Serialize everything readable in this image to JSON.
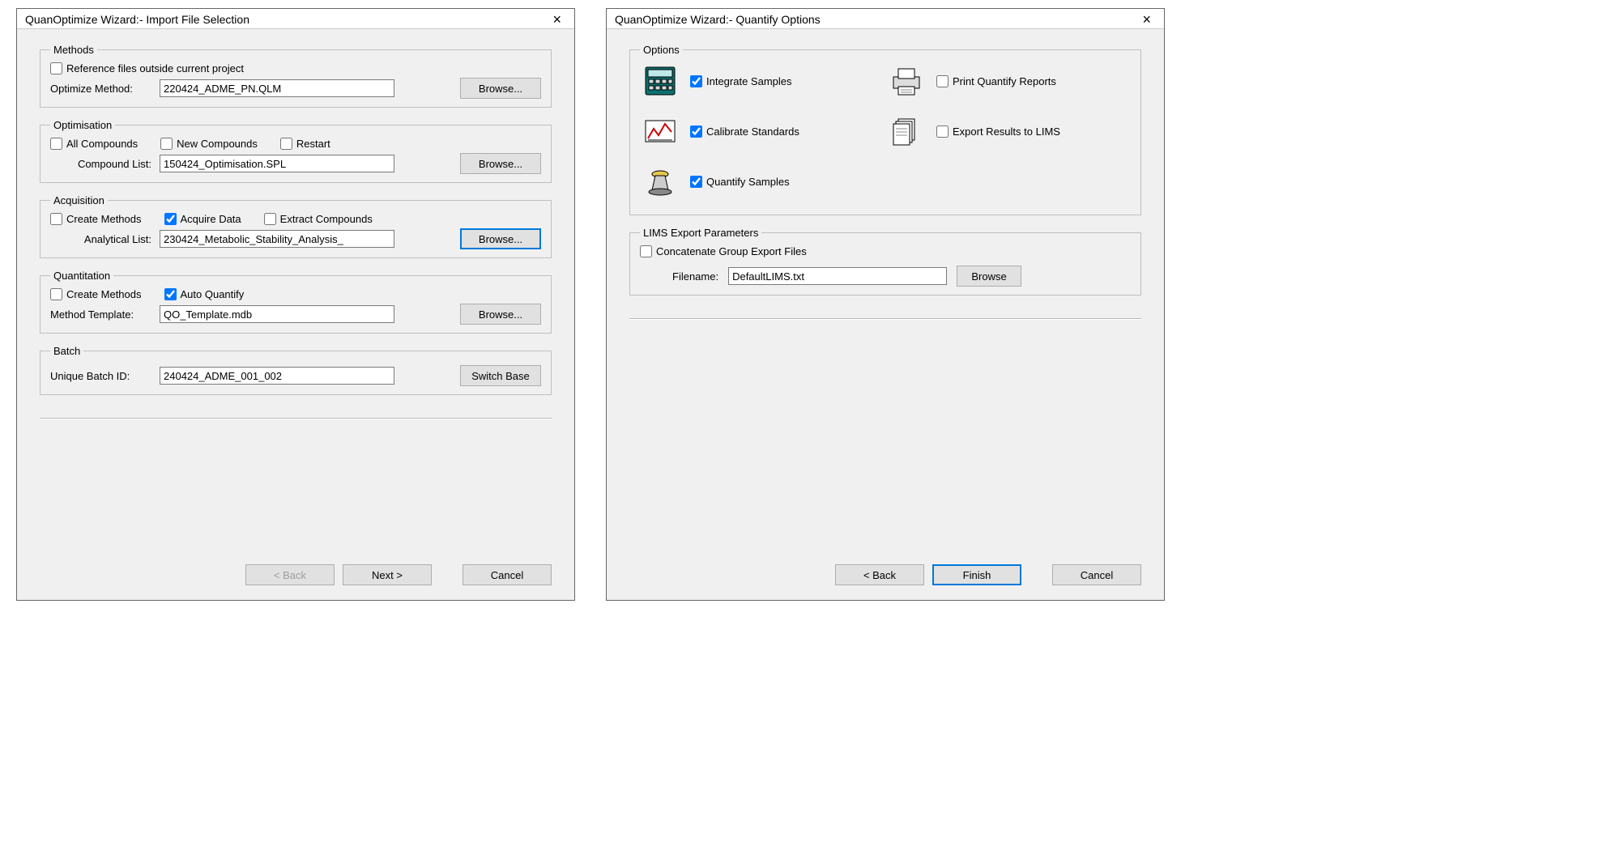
{
  "dialog1": {
    "title": "QuanOptimize Wizard:- Import File Selection",
    "methods": {
      "legend": "Methods",
      "reference_outside": "Reference files outside current project",
      "optimize_method_label": "Optimize Method:",
      "optimize_method_value": "220424_ADME_PN.QLM",
      "browse": "Browse..."
    },
    "optimisation": {
      "legend": "Optimisation",
      "all_compounds": "All Compounds",
      "new_compounds": "New Compounds",
      "restart": "Restart",
      "compound_list_label": "Compound List:",
      "compound_list_value": "150424_Optimisation.SPL",
      "browse": "Browse..."
    },
    "acquisition": {
      "legend": "Acquisition",
      "create_methods": "Create Methods",
      "acquire_data": "Acquire Data",
      "extract_compounds": "Extract Compounds",
      "analytical_list_label": "Analytical List:",
      "analytical_list_value": "230424_Metabolic_Stability_Analysis_",
      "browse": "Browse..."
    },
    "quantitation": {
      "legend": "Quantitation",
      "create_methods": "Create Methods",
      "auto_quantify": "Auto Quantify",
      "method_template_label": "Method Template:",
      "method_template_value": "QO_Template.mdb",
      "browse": "Browse..."
    },
    "batch": {
      "legend": "Batch",
      "unique_batch_label": "Unique Batch ID:",
      "unique_batch_value": "240424_ADME_001_002",
      "switch_base": "Switch Base"
    },
    "footer": {
      "back": "< Back",
      "next": "Next >",
      "cancel": "Cancel"
    }
  },
  "dialog2": {
    "title": "QuanOptimize Wizard:- Quantify Options",
    "options": {
      "legend": "Options",
      "integrate_samples": "Integrate Samples",
      "print_reports": "Print Quantify Reports",
      "calibrate_standards": "Calibrate Standards",
      "export_lims": "Export Results to LIMS",
      "quantify_samples": "Quantify Samples"
    },
    "lims": {
      "legend": "LIMS Export Parameters",
      "concat": "Concatenate Group Export Files",
      "filename_label": "Filename:",
      "filename_value": "DefaultLIMS.txt",
      "browse": "Browse"
    },
    "footer": {
      "back": "< Back",
      "finish": "Finish",
      "cancel": "Cancel"
    }
  }
}
